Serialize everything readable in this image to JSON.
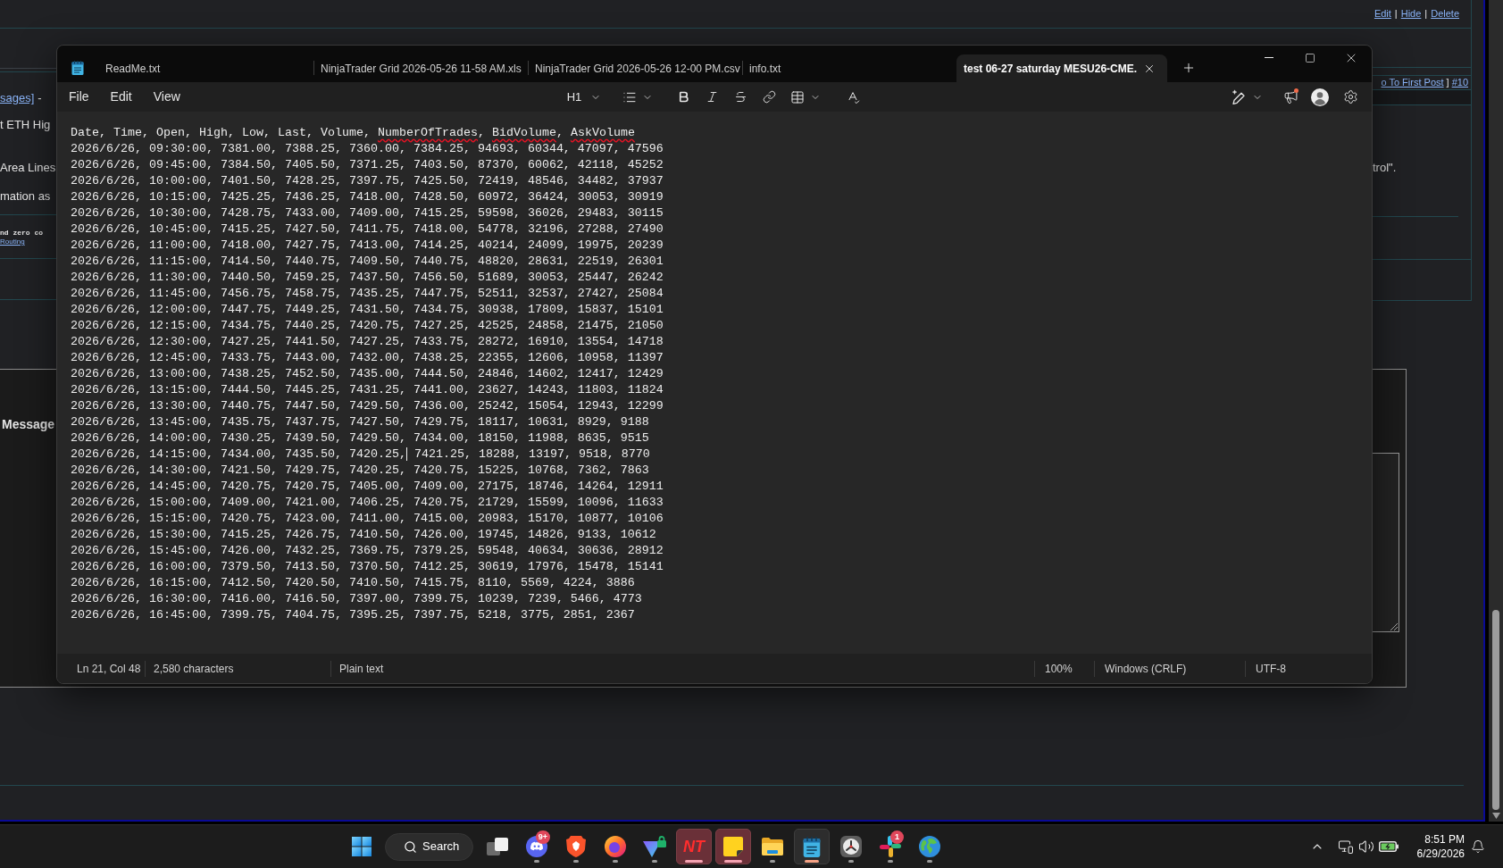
{
  "forum_page": {
    "post_actions": [
      {
        "kind": "link",
        "text": "Edit"
      },
      {
        "kind": "text",
        "text": "|"
      },
      {
        "kind": "link",
        "text": "Hide"
      },
      {
        "kind": "text",
        "text": "|"
      },
      {
        "kind": "link",
        "text": "Delete"
      }
    ],
    "thread_title": [
      {
        "kind": "link",
        "text": "sages]"
      },
      {
        "kind": "text",
        "text": "-"
      }
    ],
    "post_nav": [
      {
        "kind": "link",
        "text": "o To First Post"
      },
      {
        "kind": "text",
        "text": "]"
      },
      {
        "kind": "link",
        "text": "#10"
      }
    ],
    "post_text_left": [
      "t ETH Hig",
      "Area Lines",
      "mation as"
    ],
    "post_text_right": [
      "trol\"."
    ],
    "signature": [
      {
        "kind": "text",
        "text": "nd zero co"
      },
      {
        "kind": "link",
        "text": "Routing"
      }
    ],
    "reply_label": "Message"
  },
  "notepad": {
    "tabs": [
      {
        "title": "ReadMe.txt",
        "selected": false
      },
      {
        "title": "NinjaTrader Grid 2026-05-26 11-58 AM.xls",
        "selected": false
      },
      {
        "title": "NinjaTrader Grid 2026-05-26 12-00 PM.csv",
        "selected": false
      },
      {
        "title": "info.txt",
        "selected": false
      },
      {
        "title": "test 06-27 saturday MESU26-CME.",
        "selected": true
      }
    ],
    "menu": [
      "File",
      "Edit",
      "View"
    ],
    "toolbar": {
      "heading": "H1",
      "news_dot": true
    },
    "lines": [
      {
        "parts": [
          {
            "text": "Date, Time, Open, High, Low, Last, Volume, ",
            "misspelled": false,
            "caret_after": false
          },
          {
            "text": "NumberOfTrades",
            "misspelled": true,
            "caret_after": false
          },
          {
            "text": ", ",
            "misspelled": false,
            "caret_after": false
          },
          {
            "text": "BidVolume",
            "misspelled": true,
            "caret_after": false
          },
          {
            "text": ", ",
            "misspelled": false,
            "caret_after": false
          },
          {
            "text": "AskVolume",
            "misspelled": true,
            "caret_after": false
          }
        ]
      },
      {
        "parts": [
          {
            "text": "2026/6/26, 09:30:00, 7381.00, 7388.25, 7360.00, 7384.25, 94693, 60344, 47097, 47596",
            "misspelled": false,
            "caret_after": false
          }
        ]
      },
      {
        "parts": [
          {
            "text": "2026/6/26, 09:45:00, 7384.50, 7405.50, 7371.25, 7403.50, 87370, 60062, 42118, 45252",
            "misspelled": false,
            "caret_after": false
          }
        ]
      },
      {
        "parts": [
          {
            "text": "2026/6/26, 10:00:00, 7401.50, 7428.25, 7397.75, 7425.50, 72419, 48546, 34482, 37937",
            "misspelled": false,
            "caret_after": false
          }
        ]
      },
      {
        "parts": [
          {
            "text": "2026/6/26, 10:15:00, 7425.25, 7436.25, 7418.00, 7428.50, 60972, 36424, 30053, 30919",
            "misspelled": false,
            "caret_after": false
          }
        ]
      },
      {
        "parts": [
          {
            "text": "2026/6/26, 10:30:00, 7428.75, 7433.00, 7409.00, 7415.25, 59598, 36026, 29483, 30115",
            "misspelled": false,
            "caret_after": false
          }
        ]
      },
      {
        "parts": [
          {
            "text": "2026/6/26, 10:45:00, 7415.25, 7427.50, 7411.75, 7418.00, 54778, 32196, 27288, 27490",
            "misspelled": false,
            "caret_after": false
          }
        ]
      },
      {
        "parts": [
          {
            "text": "2026/6/26, 11:00:00, 7418.00, 7427.75, 7413.00, 7414.25, 40214, 24099, 19975, 20239",
            "misspelled": false,
            "caret_after": false
          }
        ]
      },
      {
        "parts": [
          {
            "text": "2026/6/26, 11:15:00, 7414.50, 7440.75, 7409.50, 7440.75, 48820, 28631, 22519, 26301",
            "misspelled": false,
            "caret_after": false
          }
        ]
      },
      {
        "parts": [
          {
            "text": "2026/6/26, 11:30:00, 7440.50, 7459.25, 7437.50, 7456.50, 51689, 30053, 25447, 26242",
            "misspelled": false,
            "caret_after": false
          }
        ]
      },
      {
        "parts": [
          {
            "text": "2026/6/26, 11:45:00, 7456.75, 7458.75, 7435.25, 7447.75, 52511, 32537, 27427, 25084",
            "misspelled": false,
            "caret_after": false
          }
        ]
      },
      {
        "parts": [
          {
            "text": "2026/6/26, 12:00:00, 7447.75, 7449.25, 7431.50, 7434.75, 30938, 17809, 15837, 15101",
            "misspelled": false,
            "caret_after": false
          }
        ]
      },
      {
        "parts": [
          {
            "text": "2026/6/26, 12:15:00, 7434.75, 7440.25, 7420.75, 7427.25, 42525, 24858, 21475, 21050",
            "misspelled": false,
            "caret_after": false
          }
        ]
      },
      {
        "parts": [
          {
            "text": "2026/6/26, 12:30:00, 7427.25, 7441.50, 7427.25, 7433.75, 28272, 16910, 13554, 14718",
            "misspelled": false,
            "caret_after": false
          }
        ]
      },
      {
        "parts": [
          {
            "text": "2026/6/26, 12:45:00, 7433.75, 7443.00, 7432.00, 7438.25, 22355, 12606, 10958, 11397",
            "misspelled": false,
            "caret_after": false
          }
        ]
      },
      {
        "parts": [
          {
            "text": "2026/6/26, 13:00:00, 7438.25, 7452.50, 7435.00, 7444.50, 24846, 14602, 12417, 12429",
            "misspelled": false,
            "caret_after": false
          }
        ]
      },
      {
        "parts": [
          {
            "text": "2026/6/26, 13:15:00, 7444.50, 7445.25, 7431.25, 7441.00, 23627, 14243, 11803, 11824",
            "misspelled": false,
            "caret_after": false
          }
        ]
      },
      {
        "parts": [
          {
            "text": "2026/6/26, 13:30:00, 7440.75, 7447.50, 7429.50, 7436.00, 25242, 15054, 12943, 12299",
            "misspelled": false,
            "caret_after": false
          }
        ]
      },
      {
        "parts": [
          {
            "text": "2026/6/26, 13:45:00, 7435.75, 7437.75, 7427.50, 7429.75, 18117, 10631, 8929, 9188",
            "misspelled": false,
            "caret_after": false
          }
        ]
      },
      {
        "parts": [
          {
            "text": "2026/6/26, 14:00:00, 7430.25, 7439.50, 7429.50, 7434.00, 18150, 11988, 8635, 9515",
            "misspelled": false,
            "caret_after": false
          }
        ]
      },
      {
        "parts": [
          {
            "text": "2026/6/26, 14:15:00, 7434.00, 7435.50, 7420.25,",
            "misspelled": false,
            "caret_after": true
          },
          {
            "text": " 7421.25, 18288, 13197, 9518, 8770",
            "misspelled": false,
            "caret_after": false
          }
        ]
      },
      {
        "parts": [
          {
            "text": "2026/6/26, 14:30:00, 7421.50, 7429.75, 7420.25, 7420.75, 15225, 10768, 7362, 7863",
            "misspelled": false,
            "caret_after": false
          }
        ]
      },
      {
        "parts": [
          {
            "text": "2026/6/26, 14:45:00, 7420.75, 7420.75, 7405.00, 7409.00, 27175, 18746, 14264, 12911",
            "misspelled": false,
            "caret_after": false
          }
        ]
      },
      {
        "parts": [
          {
            "text": "2026/6/26, 15:00:00, 7409.00, 7421.00, 7406.25, 7420.75, 21729, 15599, 10096, 11633",
            "misspelled": false,
            "caret_after": false
          }
        ]
      },
      {
        "parts": [
          {
            "text": "2026/6/26, 15:15:00, 7420.75, 7423.00, 7411.00, 7415.00, 20983, 15170, 10877, 10106",
            "misspelled": false,
            "caret_after": false
          }
        ]
      },
      {
        "parts": [
          {
            "text": "2026/6/26, 15:30:00, 7415.25, 7426.75, 7410.50, 7426.00, 19745, 14826, 9133, 10612",
            "misspelled": false,
            "caret_after": false
          }
        ]
      },
      {
        "parts": [
          {
            "text": "2026/6/26, 15:45:00, 7426.00, 7432.25, 7369.75, 7379.25, 59548, 40634, 30636, 28912",
            "misspelled": false,
            "caret_after": false
          }
        ]
      },
      {
        "parts": [
          {
            "text": "2026/6/26, 16:00:00, 7379.50, 7413.50, 7370.50, 7412.25, 30619, 17976, 15478, 15141",
            "misspelled": false,
            "caret_after": false
          }
        ]
      },
      {
        "parts": [
          {
            "text": "2026/6/26, 16:15:00, 7412.50, 7420.50, 7410.50, 7415.75, 8110, 5569, 4224, 3886",
            "misspelled": false,
            "caret_after": false
          }
        ]
      },
      {
        "parts": [
          {
            "text": "2026/6/26, 16:30:00, 7416.00, 7416.50, 7397.00, 7399.75, 10239, 7239, 5466, 4773",
            "misspelled": false,
            "caret_after": false
          }
        ]
      },
      {
        "parts": [
          {
            "text": "2026/6/26, 16:45:00, 7399.75, 7404.75, 7395.25, 7397.75, 5218, 3775, 2851, 2367",
            "misspelled": false,
            "caret_after": false
          }
        ]
      }
    ],
    "status_bar": [
      "Ln 21, Col 48",
      "2,580 characters",
      "Plain text",
      "100%",
      "Windows (CRLF)",
      "UTF-8"
    ]
  },
  "taskbar": {
    "search": {
      "label": "Search"
    },
    "apps": [
      {
        "kind": "taskview",
        "running": false,
        "flashing": false,
        "selected": false
      },
      {
        "kind": "chat",
        "badge": "9+",
        "running": true,
        "flashing": false,
        "selected": false
      },
      {
        "kind": "shield",
        "running": true,
        "flashing": false,
        "selected": false
      },
      {
        "kind": "fox",
        "running": true,
        "flashing": false,
        "selected": false
      },
      {
        "kind": "vpn",
        "running": true,
        "flashing": false,
        "selected": false
      },
      {
        "kind": "trading",
        "logo_text": "NT",
        "running": true,
        "flashing": true,
        "selected": false
      },
      {
        "kind": "notes",
        "running": true,
        "flashing": true,
        "selected": false
      },
      {
        "kind": "folder",
        "running": true,
        "flashing": false,
        "selected": false
      },
      {
        "kind": "notepad",
        "running": true,
        "flashing": false,
        "selected": true
      },
      {
        "kind": "clock",
        "running": true,
        "flashing": false,
        "selected": false
      },
      {
        "kind": "pinwheel",
        "badge": "1",
        "running": true,
        "flashing": false,
        "selected": false
      },
      {
        "kind": "globe",
        "running": true,
        "flashing": false,
        "selected": false
      }
    ],
    "clock": {
      "time": "8:51 PM",
      "date": "6/29/2026"
    }
  }
}
